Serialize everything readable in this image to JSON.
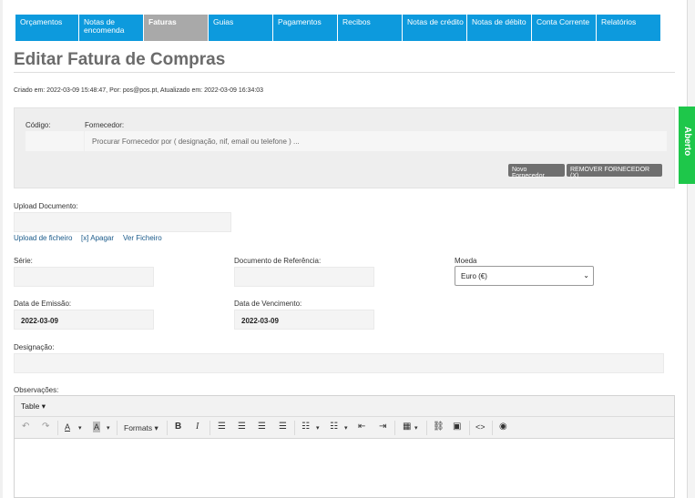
{
  "nav": {
    "tabs": [
      {
        "label": "Orçamentos"
      },
      {
        "label": "Notas de encomenda"
      },
      {
        "label": "Faturas",
        "active": true
      },
      {
        "label": "Guias"
      },
      {
        "label": "Pagamentos"
      },
      {
        "label": "Recibos"
      },
      {
        "label": "Notas de crédito"
      },
      {
        "label": "Notas de débito"
      },
      {
        "label": "Conta Corrente"
      },
      {
        "label": "Relatórios"
      }
    ]
  },
  "page": {
    "title": "Editar Fatura de Compras",
    "meta": "Criado em: 2022-03-09 15:48:47, Por: pos@pos.pt, Atualizado em: 2022-03-09 16:34:03",
    "status_tab": "Aberto"
  },
  "supplier": {
    "code_label": "Código:",
    "supplier_label": "Fornecedor:",
    "supplier_placeholder": "Procurar Fornecedor por ( designação, nif, email ou telefone ) ...",
    "new_button": "Novo Fornecedor",
    "remove_button": "REMOVER FORNECEDOR (X)"
  },
  "upload": {
    "label": "Upload Documento:",
    "upload_link": "Upload de ficheiro",
    "delete_link": "[x] Apagar",
    "view_link": "Ver Ficheiro"
  },
  "form": {
    "serie_label": "Série:",
    "ref_label": "Documento de Referência:",
    "currency_label": "Moeda",
    "currency_value": "Euro (€)",
    "emission_label": "Data de Emissão:",
    "emission_value": "2022-03-09",
    "due_label": "Data de Vencimento:",
    "due_value": "2022-03-09",
    "designation_label": "Designação:",
    "notes_label": "Observações:"
  },
  "editor": {
    "menu_table": "Table",
    "formats_label": "Formats"
  },
  "colors": {
    "tab_blue": "#0d9add",
    "tab_active": "#a9a9a9",
    "status_green": "#1ec74a"
  }
}
